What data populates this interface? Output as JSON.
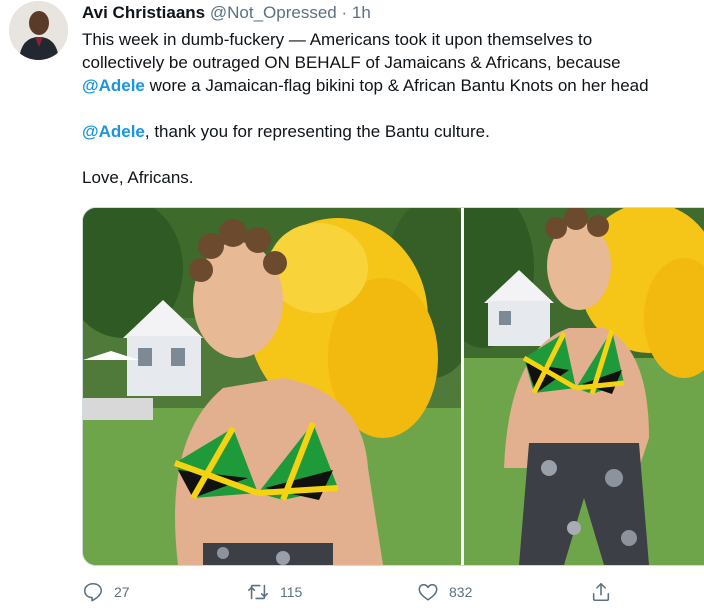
{
  "author": {
    "name": "Avi Christiaans",
    "handle": "@Not_Opressed",
    "separator": "·",
    "time": "1h"
  },
  "tweet": {
    "line1": "This week in dumb-fuckery —  Americans took it upon themselves to",
    "line2": "collectively be outraged ON BEHALF of Jamaicans & Africans, because",
    "line3_mention": "@Adele",
    "line3_rest": " wore a Jamaican-flag bikini top & African Bantu Knots on her head",
    "line4_mention": "@Adele",
    "line4_rest": ", thank you for representing the Bantu culture.",
    "line5": "Love, Africans."
  },
  "actions": {
    "replies": "27",
    "retweets": "115",
    "likes": "832"
  },
  "colors": {
    "link": "#1b95e0",
    "muted": "#5b7083",
    "feather": "#f5c518",
    "grass": "#6fa54a"
  },
  "icons": {
    "reply": "reply-icon",
    "retweet": "retweet-icon",
    "like": "heart-icon",
    "share": "share-icon"
  }
}
